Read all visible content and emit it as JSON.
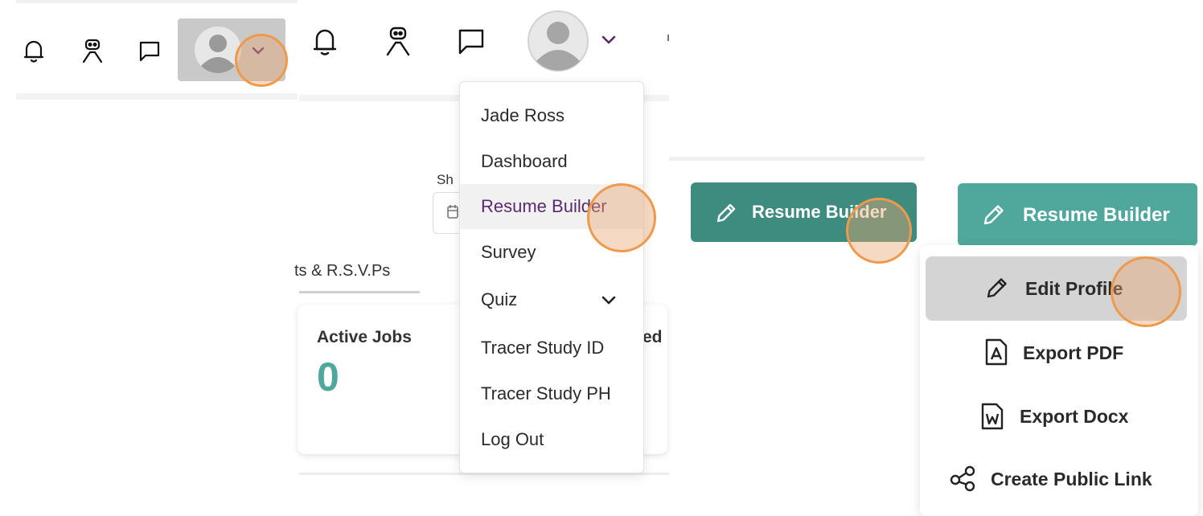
{
  "panel1": {
    "icons": [
      "bell-icon",
      "bot-icon",
      "chat-icon",
      "avatar-icon",
      "chevron-down-icon"
    ]
  },
  "panel2": {
    "search_label_partial": "Sh",
    "tab_label_partial": "ts & R.S.V.Ps",
    "card_title": "Active Jobs",
    "card_value": "0",
    "card2_title_partial": "ed",
    "menu": {
      "items": [
        {
          "label": "Jade Ross"
        },
        {
          "label": "Dashboard"
        },
        {
          "label": "Resume Builder",
          "active": true
        },
        {
          "label": "Survey"
        },
        {
          "label": "Quiz",
          "has_submenu": true
        },
        {
          "label": "Tracer Study ID"
        },
        {
          "label": "Tracer Study PH"
        },
        {
          "label": "Log Out"
        }
      ]
    }
  },
  "panel3": {
    "button_label": "Resume Builder"
  },
  "panel4": {
    "button_label": "Resume Builder",
    "options": [
      {
        "label": "Edit Profile",
        "icon": "pencil-icon"
      },
      {
        "label": "Export PDF",
        "icon": "pdf-file-icon"
      },
      {
        "label": "Export Docx",
        "icon": "word-file-icon"
      },
      {
        "label": "Create Public Link",
        "icon": "share-icon"
      }
    ]
  },
  "colors": {
    "accent_purple": "#5b2a6e",
    "teal_dark": "#3e8c80",
    "teal": "#4fa89b",
    "highlight_orange": "#ee9a4a"
  }
}
